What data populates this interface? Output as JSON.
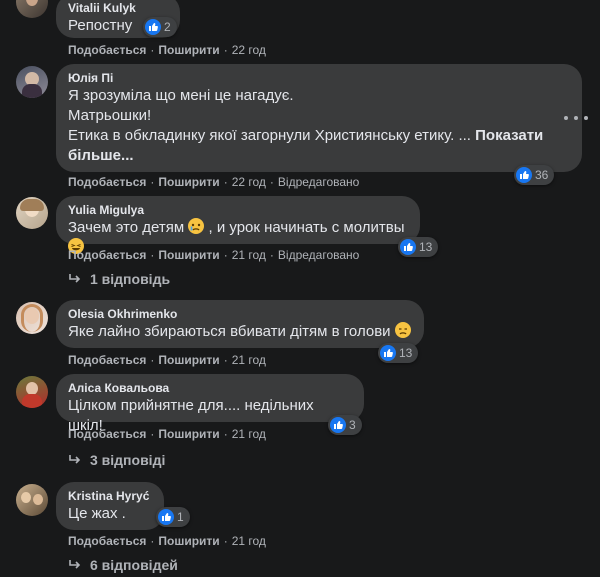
{
  "comments": [
    {
      "author": "Vitalii Kulyk",
      "lines": [
        "Репостну"
      ],
      "reactions": "2",
      "actions": {
        "like": "Подобається",
        "share": "Поширити",
        "time": "22 год",
        "edited": ""
      }
    },
    {
      "author": "Юлія Пі",
      "lines": [
        "Я зрозуміла що мені це нагадує.",
        "Матрьошки!",
        "Етика в обкладинку якої загорнули Християнську етику. ... "
      ],
      "see_more": "Показати більше...",
      "see_more_part1": "Показати",
      "see_more_part2": "більше...",
      "reactions": "36",
      "actions": {
        "like": "Подобається",
        "share": "Поширити",
        "time": "22 год",
        "edited": "Відредаговано"
      }
    },
    {
      "author": "Yulia Migulya",
      "text_a": "Зачем это детям ",
      "text_b": " , и урок начинать с молитвы ",
      "reactions": "13",
      "actions": {
        "like": "Подобається",
        "share": "Поширити",
        "time": "21 год",
        "edited": "Відредаговано"
      },
      "replies": "1 відповідь"
    },
    {
      "author": "Olesia Okhrimenko",
      "text_a": "Яке лайно збираються вбивати дітям в голови ",
      "reactions": "13",
      "actions": {
        "like": "Подобається",
        "share": "Поширити",
        "time": "21 год",
        "edited": ""
      }
    },
    {
      "author": "Аліса Ковальова",
      "text_a": "Цілком прийнятне для.... недільних шкіл!",
      "reactions": "3",
      "actions": {
        "like": "Подобається",
        "share": "Поширити",
        "time": "21 год",
        "edited": ""
      },
      "replies": "3 відповіді"
    },
    {
      "author": "Kristina Hyryć",
      "text_a": "Це жах .",
      "reactions": "1",
      "actions": {
        "like": "Подобається",
        "share": "Поширити",
        "time": "21 год",
        "edited": ""
      },
      "replies": "6 відповідей"
    }
  ],
  "colors": {
    "background": "#18191a",
    "bubble": "#3a3b3c",
    "like_blue": "#1877f2",
    "secondary_text": "#b0b3b8"
  },
  "icons": [
    "like-icon",
    "reply-arrow-icon",
    "more-options-icon",
    "crying-emoji",
    "laughing-emoji",
    "disappointed-emoji"
  ]
}
